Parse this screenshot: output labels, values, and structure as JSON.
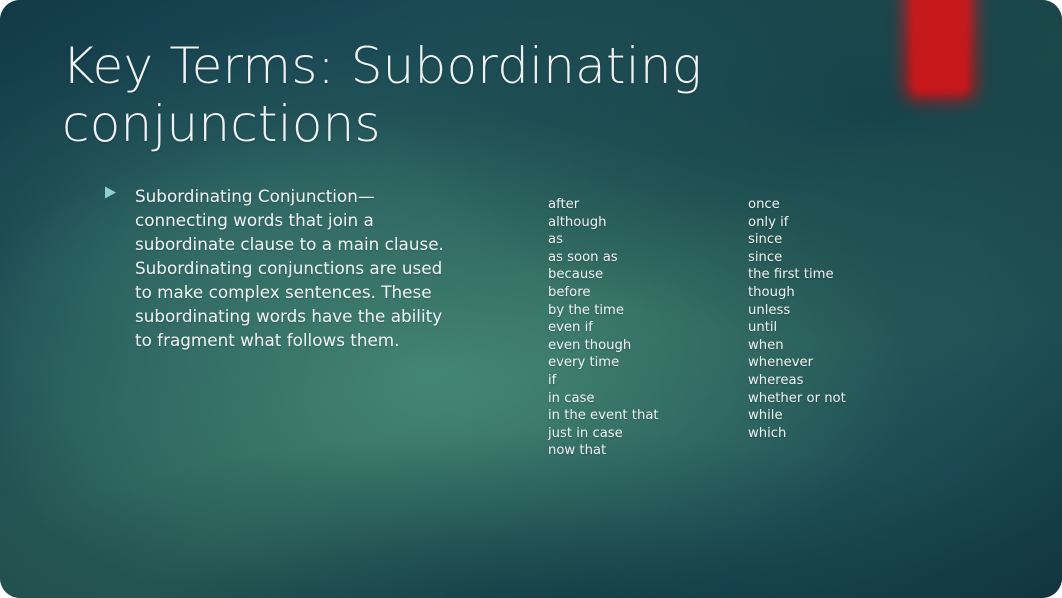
{
  "slide": {
    "title": "Key Terms: Subordinating conjunctions",
    "body_paragraph": "Subordinating Conjunction—connecting words that join a subordinate clause to a main clause. Subordinating conjunctions are used to make complex sentences. These subordinating words have the ability to fragment what follows them.",
    "bullet_glyph": "triangle-right",
    "word_columns": [
      {
        "items": [
          "after",
          "although",
          "as",
          "as soon as",
          "because",
          "before",
          "by the time",
          "even if",
          "even though",
          "every time",
          "if",
          "in case",
          "in the event that",
          "just in case",
          "now that"
        ]
      },
      {
        "items": [
          "once",
          "only if",
          "since",
          "since",
          "the first time",
          "though",
          "unless",
          "until",
          "when",
          "whenever",
          "whereas",
          "whether or not",
          "while",
          "which"
        ]
      }
    ],
    "colors": {
      "background_dark": "#15404e",
      "background_mid": "#2d6258",
      "background_edge": "#123b47",
      "title_text": "#eef1f0",
      "body_text": "#f2f4f3",
      "bullet_accent": "#8ecfcf",
      "red_accent": "#c7191c",
      "page_outside": "#ffffff"
    }
  }
}
